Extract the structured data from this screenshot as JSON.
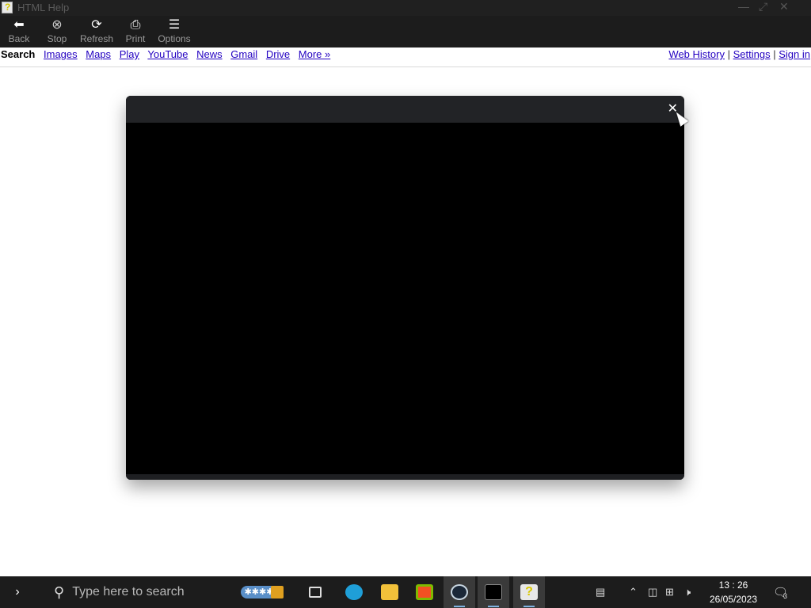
{
  "titlebar": {
    "title": "HTML Help",
    "minimize": "—",
    "maximize": "⤢",
    "close": "✕"
  },
  "toolbar": {
    "buttons": [
      {
        "label": "Back",
        "icon": "back-arrow-icon"
      },
      {
        "label": "Stop",
        "icon": "stop-icon"
      },
      {
        "label": "Refresh",
        "icon": "refresh-icon"
      },
      {
        "label": "Print",
        "icon": "printer-icon"
      },
      {
        "label": "Options",
        "icon": "options-icon"
      }
    ]
  },
  "nav": {
    "current": "Search",
    "links": [
      "Images",
      "Maps",
      "Play",
      "YouTube",
      "News",
      "Gmail",
      "Drive",
      "More »"
    ],
    "right": [
      "Web History",
      "Settings",
      "Sign in"
    ],
    "sep": "|"
  },
  "dialog": {
    "close": "✕"
  },
  "taskbar": {
    "search_placeholder": "Type here to search",
    "time": "13 : 26",
    "date": "26/05/2023",
    "notif_count": "3"
  }
}
